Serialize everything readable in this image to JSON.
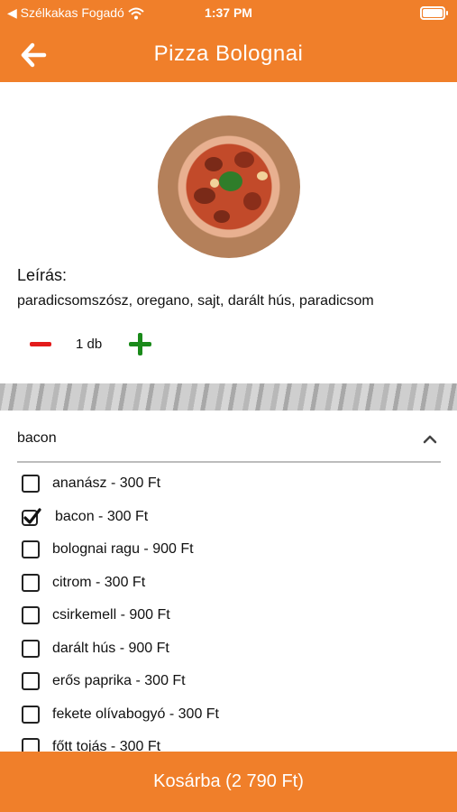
{
  "status_bar": {
    "carrier": "◀ Szélkakas Fogadó",
    "time": "1:37 PM"
  },
  "header": {
    "title": "Pizza Bolognai"
  },
  "description": {
    "label": "Leírás:",
    "text": "paradicsomszósz, oregano, sajt, darált hús, paradicsom"
  },
  "quantity": {
    "value_text": "1 db"
  },
  "dropdown": {
    "selected": "bacon"
  },
  "toppings": [
    {
      "label": "ananász - 300 Ft",
      "checked": false
    },
    {
      "label": "bacon - 300 Ft",
      "checked": true
    },
    {
      "label": "bolognai ragu - 900 Ft",
      "checked": false
    },
    {
      "label": "citrom - 300 Ft",
      "checked": false
    },
    {
      "label": "csirkemell - 900 Ft",
      "checked": false
    },
    {
      "label": "darált hús - 900 Ft",
      "checked": false
    },
    {
      "label": "erős paprika - 300 Ft",
      "checked": false
    },
    {
      "label": "fekete olívabogyó - 300 Ft",
      "checked": false
    },
    {
      "label": "főtt tojás - 300 Ft",
      "checked": false
    }
  ],
  "cart_button": {
    "label": "Kosárba (2 790 Ft)"
  },
  "colors": {
    "accent": "#f07f2a",
    "minus": "#e31b1b",
    "plus": "#1a8a1a"
  }
}
